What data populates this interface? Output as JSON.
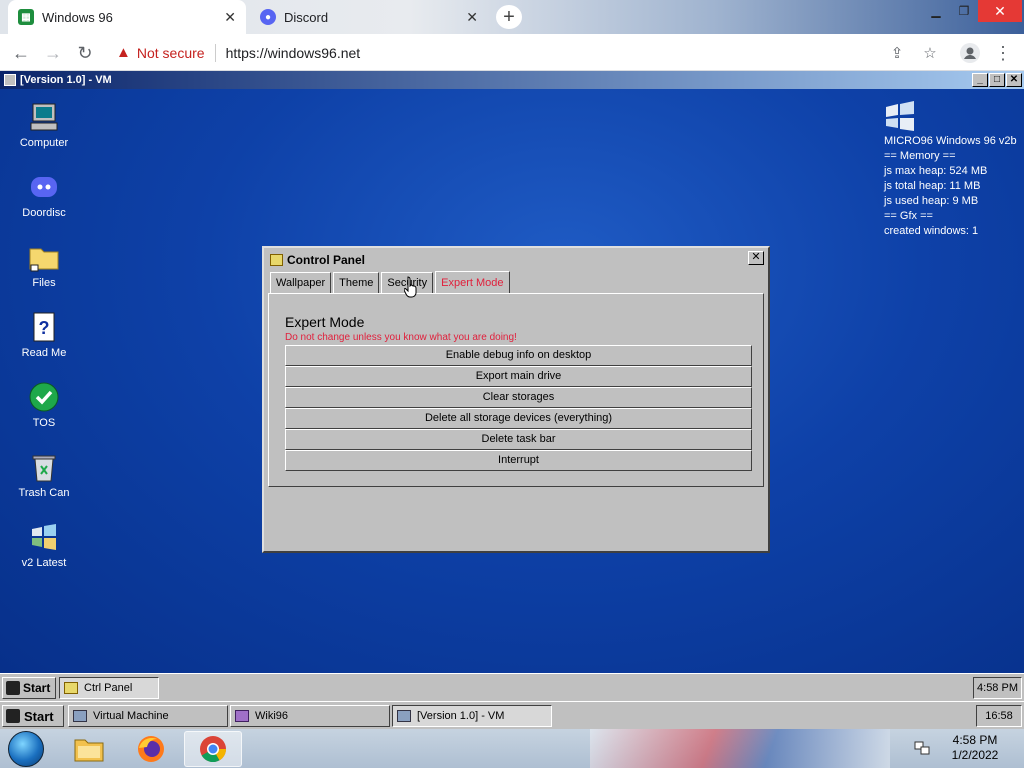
{
  "browser": {
    "tabs": [
      {
        "title": "Windows 96",
        "active": true
      },
      {
        "title": "Discord",
        "active": false
      }
    ],
    "security_label": "Not secure",
    "url": "https://windows96.net"
  },
  "vm_window": {
    "title": "[Version 1.0] - VM"
  },
  "desktop_icons": [
    {
      "label": "Computer",
      "icon": "computer-icon"
    },
    {
      "label": "Doordisc",
      "icon": "discord-icon"
    },
    {
      "label": "Files",
      "icon": "folder-icon"
    },
    {
      "label": "Read Me",
      "icon": "readme-icon"
    },
    {
      "label": "TOS",
      "icon": "checkmark-icon"
    },
    {
      "label": "Trash Can",
      "icon": "trash-icon"
    },
    {
      "label": "v2 Latest",
      "icon": "windows-logo-icon"
    }
  ],
  "sysinfo": {
    "lines": [
      "MICRO96 Windows 96 v2b",
      "== Memory ==",
      "js max heap: 524 MB",
      "js total heap: 11 MB",
      "js used heap: 9 MB",
      "== Gfx ==",
      "created windows: 1"
    ]
  },
  "control_panel": {
    "title": "Control Panel",
    "tabs": [
      "Wallpaper",
      "Theme",
      "Security",
      "Expert Mode"
    ],
    "selected_tab": "Expert Mode",
    "heading": "Expert Mode",
    "warning": "Do not change unless you know what you are doing!",
    "buttons": [
      "Enable debug info on desktop",
      "Export main drive",
      "Clear storages",
      "Delete all storage devices (everything)",
      "Delete task bar",
      "Interrupt"
    ],
    "accent_color": "#e0203c"
  },
  "taskbar96": {
    "start_label": "Start",
    "task_label": "Ctrl Panel",
    "clock": "4:58 PM"
  },
  "taskbar_vm": {
    "start_label": "Start",
    "tasks": [
      "Virtual Machine",
      "Wiki96",
      "[Version 1.0] - VM"
    ],
    "clock": "16:58"
  },
  "win7_taskbar": {
    "pinned": [
      "windows-explorer-icon",
      "firefox-icon",
      "chrome-icon"
    ],
    "time": "4:58 PM",
    "date": "1/2/2022"
  }
}
